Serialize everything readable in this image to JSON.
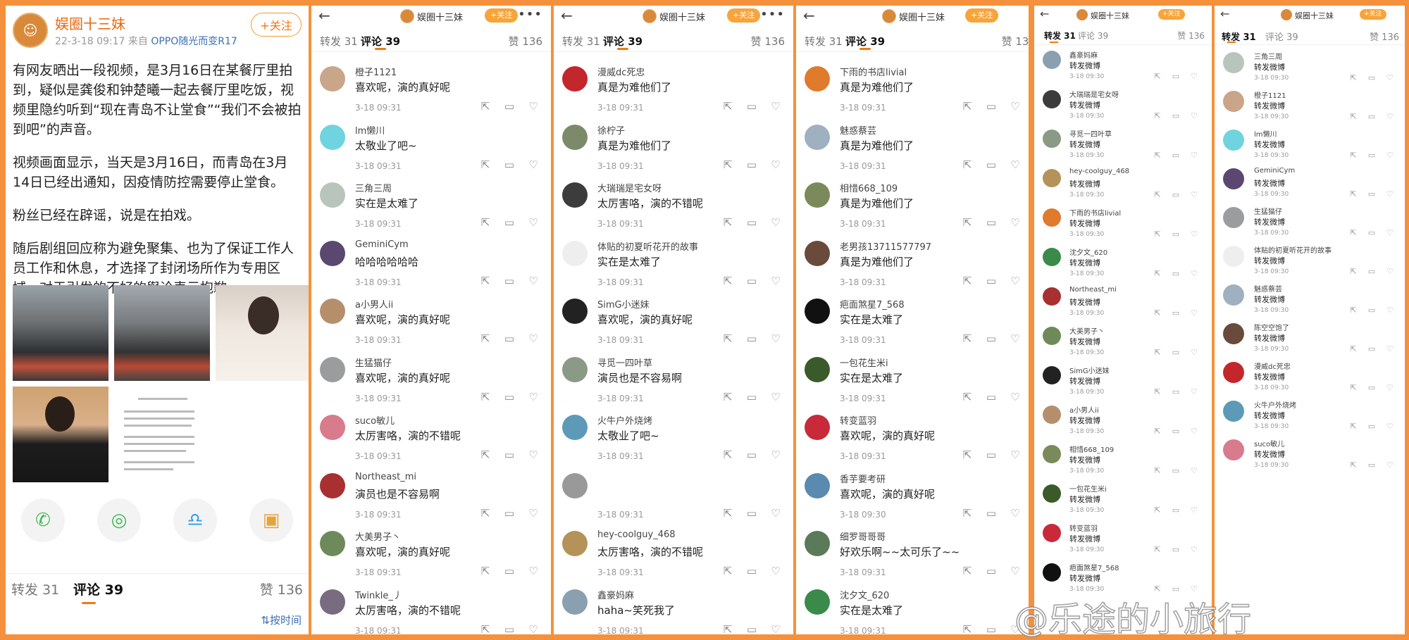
{
  "post": {
    "author": "娱圈十三妹",
    "meta_prefix": "22-3-18 09:17  来自 ",
    "source": "OPPO随光而变R17",
    "follow_label": "+关注",
    "paragraphs": [
      "有网友晒出一段视频，是3月16日在某餐厅里拍到，疑似是龚俊和钟楚曦一起去餐厅里吃饭，视频里隐约听到“现在青岛不让堂食”“我们不会被拍到吧”的声音。",
      "视频画面显示，当天是3月16日，而青岛在3月14日已经出通知，因疫情防控需要停止堂食。",
      "粉丝已经在辟谣，说是在拍戏。",
      "随后剧组回应称为避免聚集、也为了保证工作人员工作和休息，才选择了封闭场所作为专用区域，对于引发的不好的舆论表示抱歉。"
    ],
    "tabs": {
      "repost": "转发 31",
      "comment": "评论 39",
      "like": "赞 136"
    },
    "sort_label": "⇅按时间"
  },
  "share_icons": [
    "wechat-icon",
    "moments-icon",
    "qq-icon",
    "save-image-icon"
  ],
  "panel_header": {
    "author": "娱圈十三妹",
    "follow": "+关注",
    "repost_tab": "转发 31",
    "comment_tab": "评论 39",
    "like_tab": "赞 136"
  },
  "panel2": [
    {
      "user": "橙子1121",
      "text": "喜欢呢，演的真好呢",
      "time": "3-18 09:31",
      "color": "#c9a58a"
    },
    {
      "user": "lm懒川",
      "text": "太敬业了吧~",
      "time": "3-18 09:31",
      "color": "#6fd3e0"
    },
    {
      "user": "三角三周",
      "text": "实在是太难了",
      "time": "3-18 09:31",
      "color": "#b8c4bc"
    },
    {
      "user": "GeminiCym",
      "text": "哈哈哈哈哈哈",
      "time": "3-18 09:31",
      "color": "#5a4870"
    },
    {
      "user": "a小男人ii",
      "text": "喜欢呢，演的真好呢",
      "time": "3-18 09:31",
      "color": "#b58f6c"
    },
    {
      "user": "生猛猫仔",
      "text": "喜欢呢，演的真好呢",
      "time": "3-18 09:31",
      "color": "#9a9c9e"
    },
    {
      "user": "suco敏儿",
      "text": "太厉害咯，演的不错呢",
      "time": "3-18 09:31",
      "color": "#d87b8a"
    },
    {
      "user": "Northeast_mi",
      "text": "演员也是不容易啊",
      "time": "3-18 09:31",
      "color": "#a83030"
    },
    {
      "user": "大美男子丶",
      "text": "喜欢呢，演的真好呢",
      "time": "3-18 09:31",
      "color": "#6e8a5a"
    },
    {
      "user": "Twinkle_丿",
      "text": "太厉害咯，演的不错呢",
      "time": "3-18 09:31",
      "color": "#7a6c80"
    }
  ],
  "panel3": [
    {
      "user": "漫威dc死忠",
      "text": "真是为难他们了",
      "time": "3-18 09:31",
      "color": "#c3262b"
    },
    {
      "user": "徐柠子",
      "text": "真是为难他们了",
      "time": "3-18 09:31",
      "color": "#7d8a6a"
    },
    {
      "user": "大瑞瑞是宅女呀",
      "text": "太厉害咯，演的不错呢",
      "time": "3-18 09:31",
      "color": "#3c3c3c"
    },
    {
      "user": "体贴的初夏听花开的故事",
      "text": "实在是太难了",
      "time": "3-18 09:31",
      "color": "#eeeeee"
    },
    {
      "user": "SimG小迷妹",
      "text": "喜欢呢，演的真好呢",
      "time": "3-18 09:31",
      "color": "#222222"
    },
    {
      "user": "寻觅一四叶草",
      "text": "演员也是不容易啊",
      "time": "3-18 09:31",
      "color": "#8a9a86"
    },
    {
      "user": "火牛户外烧烤",
      "text": "太敬业了吧~",
      "time": "3-18 09:31",
      "color": "#5c9ab8"
    },
    {
      "user": "",
      "text": "",
      "time": "3-18 09:31",
      "color": "#999999"
    },
    {
      "user": "hey-coolguy_468",
      "text": "太厉害咯，演的不错呢",
      "time": "3-18 09:31",
      "color": "#b5925a"
    },
    {
      "user": "鑫豪妈麻",
      "text": "haha~笑死我了",
      "time": "3-18 09:31",
      "color": "#8aa0b0"
    }
  ],
  "panel4": [
    {
      "user": "下雨的书店livial",
      "text": "真是为难他们了",
      "time": "3-18 09:31",
      "color": "#e07a2c"
    },
    {
      "user": "魅惑蔡芸",
      "text": "真是为难他们了",
      "time": "3-18 09:31",
      "color": "#9fb0c0"
    },
    {
      "user": "相惜668_109",
      "text": "真是为难他们了",
      "time": "3-18 09:31",
      "color": "#7a8a5a"
    },
    {
      "user": "老男孩13711577797",
      "text": "真是为难他们了",
      "time": "3-18 09:31",
      "color": "#6a4a3a"
    },
    {
      "user": "疤面煞星7_568",
      "text": "实在是太难了",
      "time": "3-18 09:31",
      "color": "#111111"
    },
    {
      "user": "一包花生米i",
      "text": "实在是太难了",
      "time": "3-18 09:31",
      "color": "#3a5a2a"
    },
    {
      "user": "转变蓝羽",
      "text": "喜欢呢，演的真好呢",
      "time": "3-18 09:31",
      "color": "#c82a3a"
    },
    {
      "user": "香芋要考研",
      "text": "喜欢呢，演的真好呢",
      "time": "3-18 09:30",
      "color": "#5a8ab0"
    },
    {
      "user": "细罗哥哥哥",
      "text": "好欢乐啊~~太可乐了~~",
      "time": "3-18 09:31",
      "color": "#5a7a5a"
    },
    {
      "user": "沈夕文_620",
      "text": "实在是太难了",
      "time": "3-18 09:31",
      "color": "#3a8a4a"
    }
  ],
  "panel5": [
    {
      "user": "鑫豪妈麻",
      "text": "转发微博",
      "time": "3-18 09:30",
      "color": "#8aa0b0"
    },
    {
      "user": "大瑞瑞是宅女呀",
      "text": "转发微博",
      "time": "3-18 09:30",
      "color": "#3c3c3c"
    },
    {
      "user": "寻觅一四叶草",
      "text": "转发微博",
      "time": "3-18 09:30",
      "color": "#8a9a86"
    },
    {
      "user": "hey-coolguy_468",
      "text": "转发微博",
      "time": "3-18 09:30",
      "color": "#b5925a"
    },
    {
      "user": "下雨的书店livial",
      "text": "转发微博",
      "time": "3-18 09:30",
      "color": "#e07a2c"
    },
    {
      "user": "沈夕文_620",
      "text": "转发微博",
      "time": "3-18 09:30",
      "color": "#3a8a4a"
    },
    {
      "user": "Northeast_mi",
      "text": "转发微博",
      "time": "3-18 09:30",
      "color": "#a83030"
    },
    {
      "user": "大美男子丶",
      "text": "转发微博",
      "time": "3-18 09:30",
      "color": "#6e8a5a"
    },
    {
      "user": "SimG小迷妹",
      "text": "转发微博",
      "time": "3-18 09:30",
      "color": "#222222"
    },
    {
      "user": "a小男人ii",
      "text": "转发微博",
      "time": "3-18 09:30",
      "color": "#b58f6c"
    },
    {
      "user": "相惜668_109",
      "text": "转发微博",
      "time": "3-18 09:30",
      "color": "#7a8a5a"
    },
    {
      "user": "一包花生米i",
      "text": "转发微博",
      "time": "3-18 09:30",
      "color": "#3a5a2a"
    },
    {
      "user": "转变蓝羽",
      "text": "转发微博",
      "time": "3-18 09:30",
      "color": "#c82a3a"
    },
    {
      "user": "疤面煞星7_568",
      "text": "转发微博",
      "time": "3-18 09:30",
      "color": "#111111"
    }
  ],
  "panel6": [
    {
      "user": "三角三周",
      "text": "转发微博",
      "time": "3-18 09:30",
      "color": "#b8c4bc"
    },
    {
      "user": "橙子1121",
      "text": "转发微博",
      "time": "3-18 09:30",
      "color": "#c9a58a"
    },
    {
      "user": "lm懒川",
      "text": "转发微博",
      "time": "3-18 09:30",
      "color": "#6fd3e0"
    },
    {
      "user": "GeminiCym",
      "text": "转发微博",
      "time": "3-18 09:30",
      "color": "#5a4870"
    },
    {
      "user": "生猛猫仔",
      "text": "转发微博",
      "time": "3-18 09:30",
      "color": "#9a9c9e"
    },
    {
      "user": "体贴的初夏听花开的故事",
      "text": "转发微博",
      "time": "3-18 09:30",
      "color": "#eeeeee"
    },
    {
      "user": "魅惑蔡芸",
      "text": "转发微博",
      "time": "3-18 09:30",
      "color": "#9fb0c0"
    },
    {
      "user": "陈空空饱了",
      "text": "转发微博",
      "time": "3-18 09:30",
      "color": "#6a4a3a"
    },
    {
      "user": "漫威dc死忠",
      "text": "转发微博",
      "time": "3-18 09:30",
      "color": "#c3262b"
    },
    {
      "user": "火牛户外烧烤",
      "text": "转发微博",
      "time": "3-18 09:30",
      "color": "#5c9ab8"
    },
    {
      "user": "suco敏儿",
      "text": "转发微博",
      "time": "3-18 09:30",
      "color": "#d87b8a"
    }
  ],
  "watermark": "@乐途的小旅行"
}
